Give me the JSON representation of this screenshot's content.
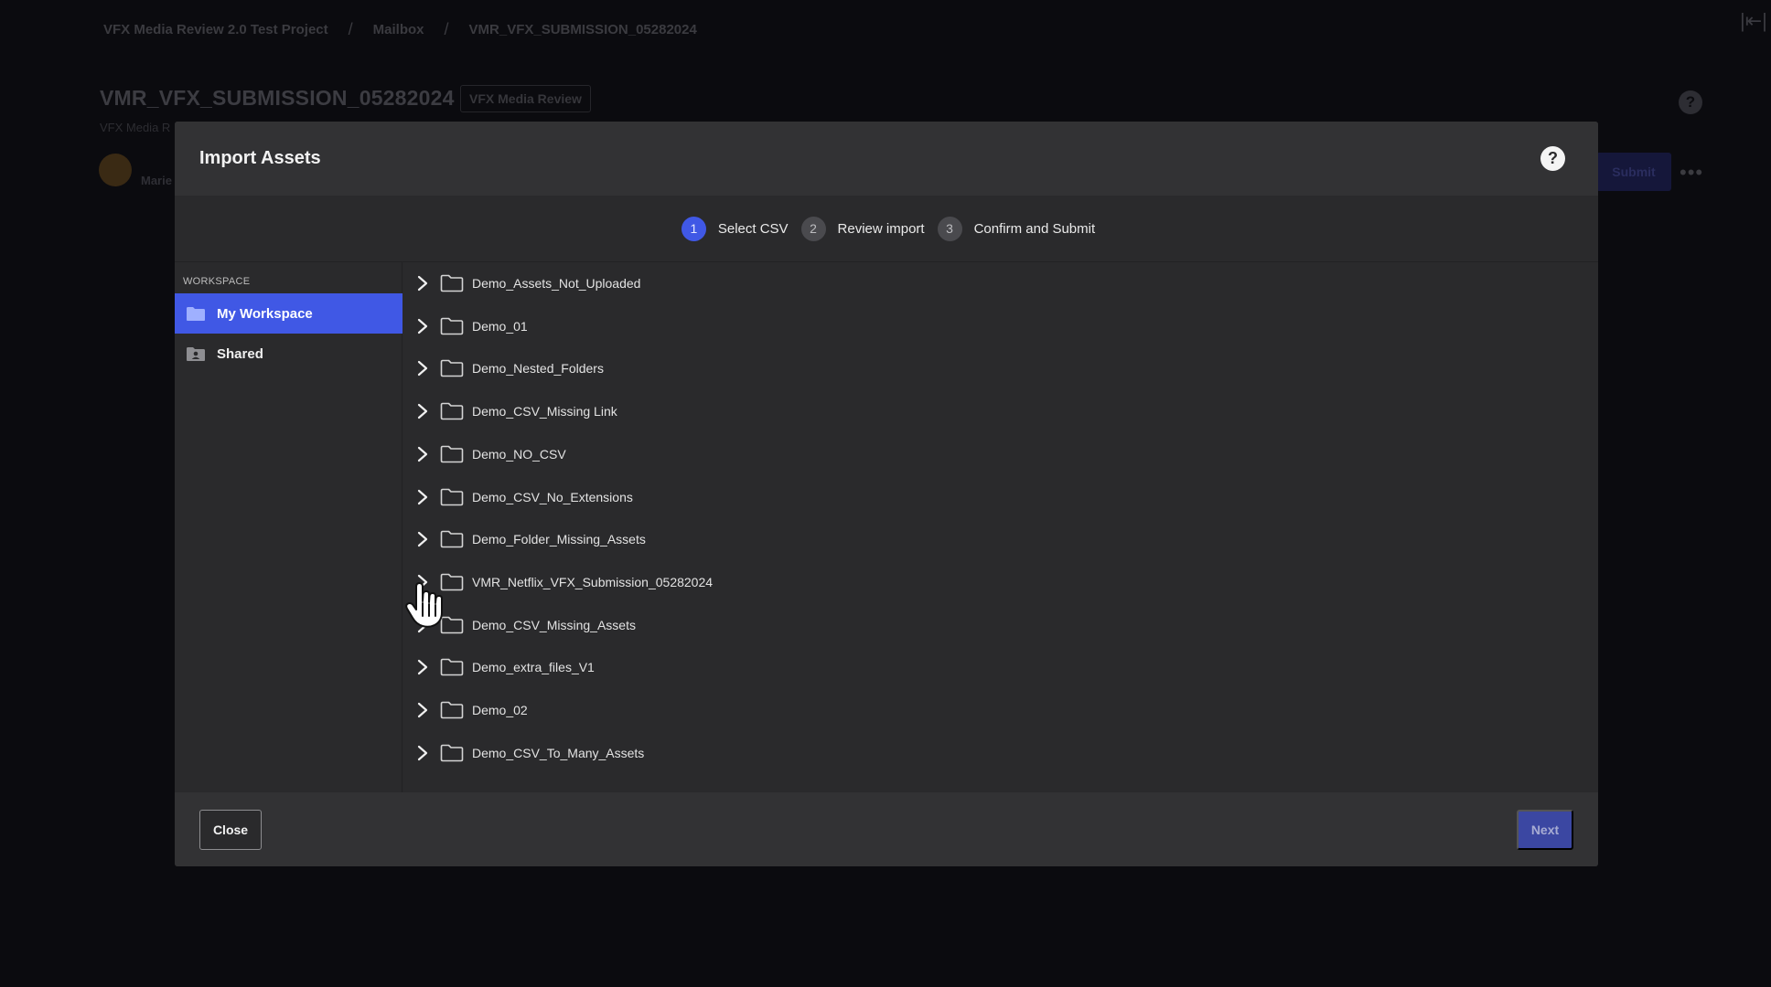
{
  "background": {
    "breadcrumb": [
      "VFX Media Review 2.0 Test Project",
      "Mailbox",
      "VMR_VFX_SUBMISSION_05282024"
    ],
    "breadcrumb_separator": "/",
    "title": "VMR_VFX_SUBMISSION_05282024",
    "badge": "VFX Media Review",
    "subtitle": "VFX Media R",
    "user_name": "Marie",
    "submit_label": "Submit",
    "more_label": "•••",
    "help_label": "?",
    "collapse_label": "|⇤|"
  },
  "modal": {
    "title": "Import Assets",
    "help_label": "?",
    "steps": [
      {
        "num": "1",
        "label": "Select CSV",
        "active": true
      },
      {
        "num": "2",
        "label": "Review import",
        "active": false
      },
      {
        "num": "3",
        "label": "Confirm and Submit",
        "active": false
      }
    ],
    "sidebar": {
      "heading": "WORKSPACE",
      "items": [
        {
          "label": "My Workspace",
          "icon": "folder-icon",
          "active": true
        },
        {
          "label": "Shared",
          "icon": "shared-folder-icon",
          "active": false
        }
      ]
    },
    "folders": [
      "Demo_Assets_Not_Uploaded",
      "Demo_01",
      "Demo_Nested_Folders",
      "Demo_CSV_Missing Link",
      "Demo_NO_CSV",
      "Demo_CSV_No_Extensions",
      "Demo_Folder_Missing_Assets",
      "VMR_Netflix_VFX_Submission_05282024",
      "Demo_CSV_Missing_Assets",
      "Demo_extra_files_V1",
      "Demo_02",
      "Demo_CSV_To_Many_Assets"
    ],
    "footer": {
      "close_label": "Close",
      "next_label": "Next"
    }
  },
  "colors": {
    "accent": "#4058e5",
    "modal_bg": "#2a2a2c",
    "header_bg": "#323234",
    "next_disabled": "#3b47a2"
  }
}
